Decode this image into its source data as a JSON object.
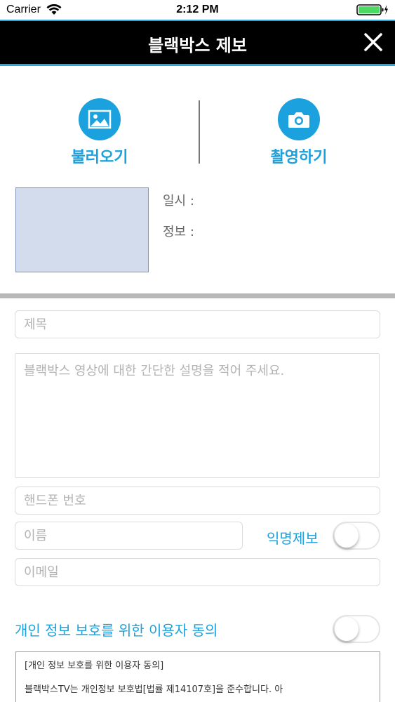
{
  "status_bar": {
    "carrier": "Carrier",
    "time": "2:12 PM"
  },
  "nav": {
    "title": "블랙박스 제보"
  },
  "media": {
    "load_label": "불러오기",
    "capture_label": "촬영하기"
  },
  "meta": {
    "datetime_label": "일시 :",
    "info_label": "정보 :"
  },
  "form": {
    "title_placeholder": "제목",
    "description_placeholder": "블랙박스 영상에 대한 간단한 설명을 적어 주세요.",
    "phone_placeholder": "핸드폰 번호",
    "name_placeholder": "이름",
    "anonymous_label": "익명제보",
    "email_placeholder": "이메일"
  },
  "consent": {
    "title": "개인 정보 보호를 위한 이용자 동의",
    "box_heading": "[개인 정보 보호를 위한 이용자 동의]",
    "box_text": "블랙박스TV는 개인정보 보호법[법률 제14107호]을 준수합니다. 아"
  },
  "colors": {
    "accent": "#1ba1de",
    "nav_background": "#000000",
    "nav_border": "#2aa6d9",
    "thumbnail_fill": "#d3dcec",
    "battery": "#4cd964"
  }
}
